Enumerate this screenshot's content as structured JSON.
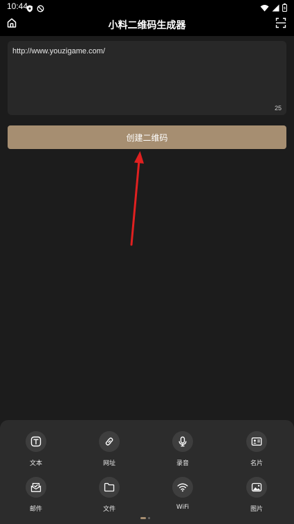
{
  "status_bar": {
    "time": "10:44",
    "left_icons": [
      "shield-icon",
      "no-disturb-icon"
    ],
    "right_icons": [
      "wifi-icon",
      "signal-icon",
      "battery-icon"
    ]
  },
  "header": {
    "title": "小料二维码生成器",
    "left_icon": "home-icon",
    "right_icon": "scan-icon"
  },
  "input": {
    "value": "http://www.youzigame.com/",
    "char_count": "25"
  },
  "create_button": {
    "label": "创建二维码"
  },
  "annotation": {
    "arrow_color": "#e02020"
  },
  "colors": {
    "accent": "#a68e71",
    "background": "#1c1c1c",
    "panel": "#2c2c2c",
    "icon_circle": "#3e3e3e"
  },
  "types": [
    {
      "label": "文本",
      "icon": "text-icon"
    },
    {
      "label": "网址",
      "icon": "link-icon"
    },
    {
      "label": "录音",
      "icon": "microphone-icon"
    },
    {
      "label": "名片",
      "icon": "business-card-icon"
    },
    {
      "label": "邮件",
      "icon": "mail-icon"
    },
    {
      "label": "文件",
      "icon": "folder-icon"
    },
    {
      "label": "WiFi",
      "icon": "wifi-icon"
    },
    {
      "label": "图片",
      "icon": "image-icon"
    }
  ],
  "pager": {
    "current": 1,
    "total": 2
  }
}
